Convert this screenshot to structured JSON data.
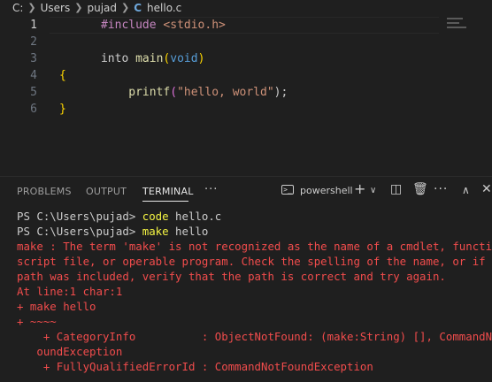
{
  "breadcrumb": {
    "drive": "C:",
    "folder1": "Users",
    "folder2": "pujad",
    "file_icon": "C",
    "file": "hello.c"
  },
  "editor": {
    "lines": [
      {
        "num": "1",
        "tokens": [
          "#include",
          " ",
          "<stdio.h>"
        ]
      },
      {
        "num": "2",
        "tokens": []
      },
      {
        "num": "3",
        "tokens": [
          "into",
          " ",
          "main",
          "(",
          "void",
          ")"
        ]
      },
      {
        "num": "4",
        "tokens": [
          "{"
        ]
      },
      {
        "num": "5",
        "tokens": [
          "    ",
          "printf",
          "(",
          "\"hello, world\"",
          ");"
        ]
      },
      {
        "num": "6",
        "tokens": [
          "}"
        ]
      }
    ]
  },
  "panel": {
    "tabs": [
      "PROBLEMS",
      "OUTPUT",
      "TERMINAL"
    ],
    "active_tab": "TERMINAL",
    "more": "···",
    "shell_icon": ">_",
    "shell": "powershell",
    "icons": [
      "plus-icon",
      "chevron-down-icon",
      "split-icon",
      "trash-icon",
      "more-icon",
      "maximize-icon",
      "close-icon"
    ]
  },
  "terminal": {
    "prompt1": "PS C:\\Users\\pujad> ",
    "cmd1": "code",
    "arg1": " hello.c",
    "prompt2": "PS C:\\Users\\pujad> ",
    "cmd2": "make",
    "arg2": " hello",
    "errors": [
      "make : The term 'make' is not recognized as the name of a cmdlet, function,",
      "script file, or operable program. Check the spelling of the name, or if a",
      "path was included, verify that the path is correct and try again.",
      "At line:1 char:1",
      "+ make hello",
      "+ ~~~~",
      "    + CategoryInfo          : ObjectNotFound: (make:String) [], CommandNotF",
      "   oundException",
      "    + FullyQualifiedErrorId : CommandNotFoundException"
    ]
  },
  "colors": {
    "background": "#1f1f1f",
    "error": "#f14c4c",
    "command": "#f5f543"
  }
}
